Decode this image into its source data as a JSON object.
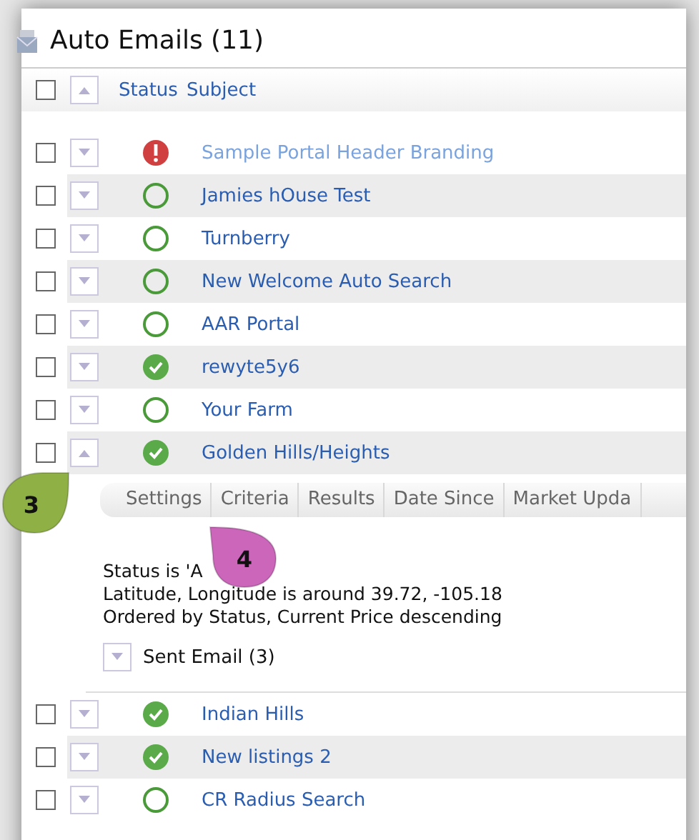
{
  "panel": {
    "title": "Auto Emails (11)"
  },
  "columns": [
    "Status",
    "Subject"
  ],
  "header_checked": false,
  "rows": [
    {
      "subject": "Sample Portal Header Branding",
      "kind": "error",
      "dimmed": true,
      "checked": false,
      "expanded": false
    },
    {
      "subject": "Jamies hOuse Test",
      "kind": "pending",
      "dimmed": false,
      "checked": false,
      "expanded": false
    },
    {
      "subject": "Turnberry",
      "kind": "pending",
      "dimmed": false,
      "checked": false,
      "expanded": false
    },
    {
      "subject": "New Welcome Auto Search",
      "kind": "pending",
      "dimmed": false,
      "checked": false,
      "expanded": false
    },
    {
      "subject": "AAR Portal",
      "kind": "pending",
      "dimmed": false,
      "checked": false,
      "expanded": false
    },
    {
      "subject": "rewyte5y6",
      "kind": "active",
      "dimmed": false,
      "checked": false,
      "expanded": false
    },
    {
      "subject": "Your Farm",
      "kind": "pending",
      "dimmed": false,
      "checked": false,
      "expanded": false
    },
    {
      "subject": "Golden Hills/Heights",
      "kind": "active",
      "dimmed": false,
      "checked": false,
      "expanded": true,
      "detail": {
        "tabs": [
          "Settings",
          "Criteria",
          "Results",
          "Date Since",
          "Market Upda"
        ],
        "lines": [
          "Status is 'A",
          "Latitude, Longitude is around 39.72, -105.18",
          "Ordered by Status, Current Price descending"
        ],
        "sent_email": "Sent Email (3)"
      }
    },
    {
      "subject": "Indian Hills",
      "kind": "active",
      "dimmed": false,
      "checked": false,
      "expanded": false
    },
    {
      "subject": "New listings 2",
      "kind": "active",
      "dimmed": false,
      "checked": false,
      "expanded": false
    },
    {
      "subject": "CR Radius Search",
      "kind": "pending",
      "dimmed": false,
      "checked": false,
      "expanded": false
    }
  ],
  "callouts": [
    {
      "label": "3",
      "color": "#8fb045"
    },
    {
      "label": "4",
      "color": "#cc66bb"
    }
  ]
}
